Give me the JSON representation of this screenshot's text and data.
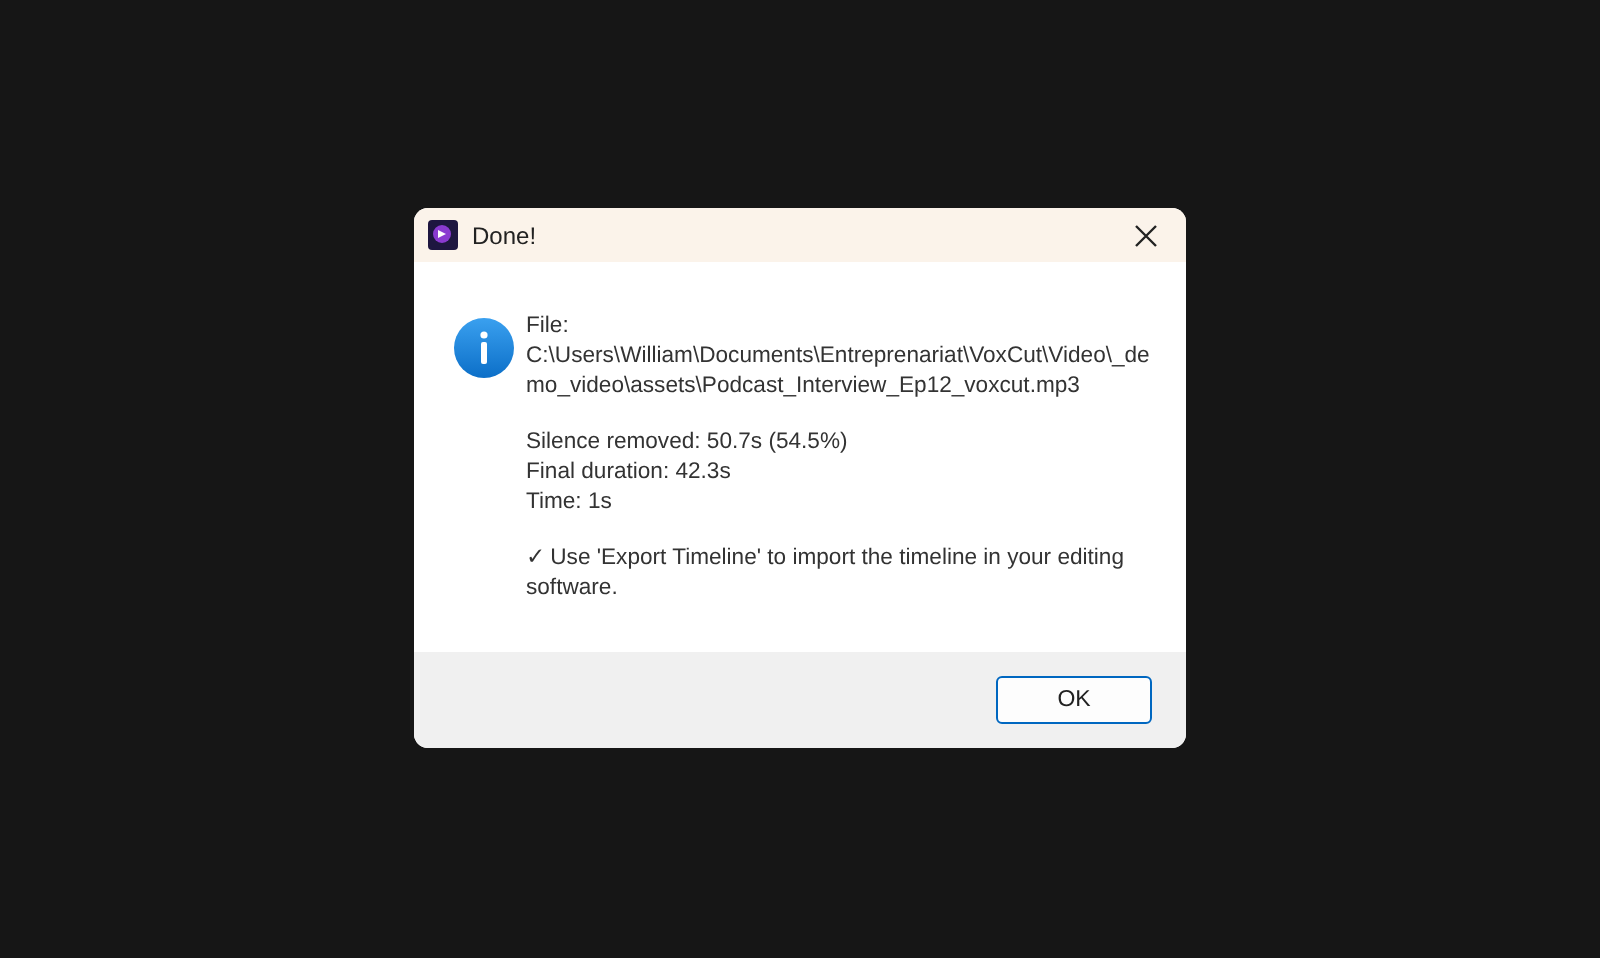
{
  "window": {
    "title": "Done!"
  },
  "dialog": {
    "kind": "info",
    "paragraphs": [
      [
        "File:",
        "C:\\Users\\William\\Documents\\Entreprenariat\\VoxCut\\Video\\_de",
        "mo_video\\assets\\Podcast_Interview_Ep12_voxcut.mp3"
      ],
      [
        "Silence removed: 50.7s (54.5%)",
        "Final duration: 42.3s",
        "Time: 1s"
      ],
      [
        "✓ Use 'Export Timeline' to import the timeline in your editing",
        "software."
      ]
    ]
  },
  "buttons": [
    {
      "label": "OK",
      "selected": true
    }
  ]
}
